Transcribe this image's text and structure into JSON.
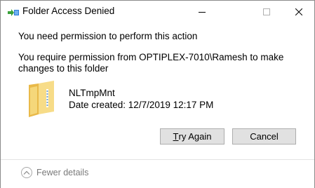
{
  "window": {
    "title": "Folder Access Denied",
    "title_icon": "folder-move-icon",
    "controls": [
      "minimize-icon",
      "maximize-icon",
      "close-icon"
    ]
  },
  "message": {
    "heading": "You need permission to perform this action",
    "description": "You require permission from OPTIPLEX-7010\\Ramesh to make changes to this folder"
  },
  "item": {
    "icon": "folder-icon",
    "name": "NLTmpMnt",
    "date_created": "Date created: 12/7/2019 12:17 PM"
  },
  "buttons": {
    "try_again_mnemonic": "T",
    "try_again_rest": "ry Again",
    "cancel": "Cancel"
  },
  "footer": {
    "details_label": "Fewer details",
    "details_icon": "chevron-up-icon"
  },
  "colors": {
    "folder_yellow": "#f5d77a",
    "arrow_green": "#3aa13a",
    "arrow_blue": "#2b7bd8",
    "button_bg": "#e1e1e1"
  }
}
